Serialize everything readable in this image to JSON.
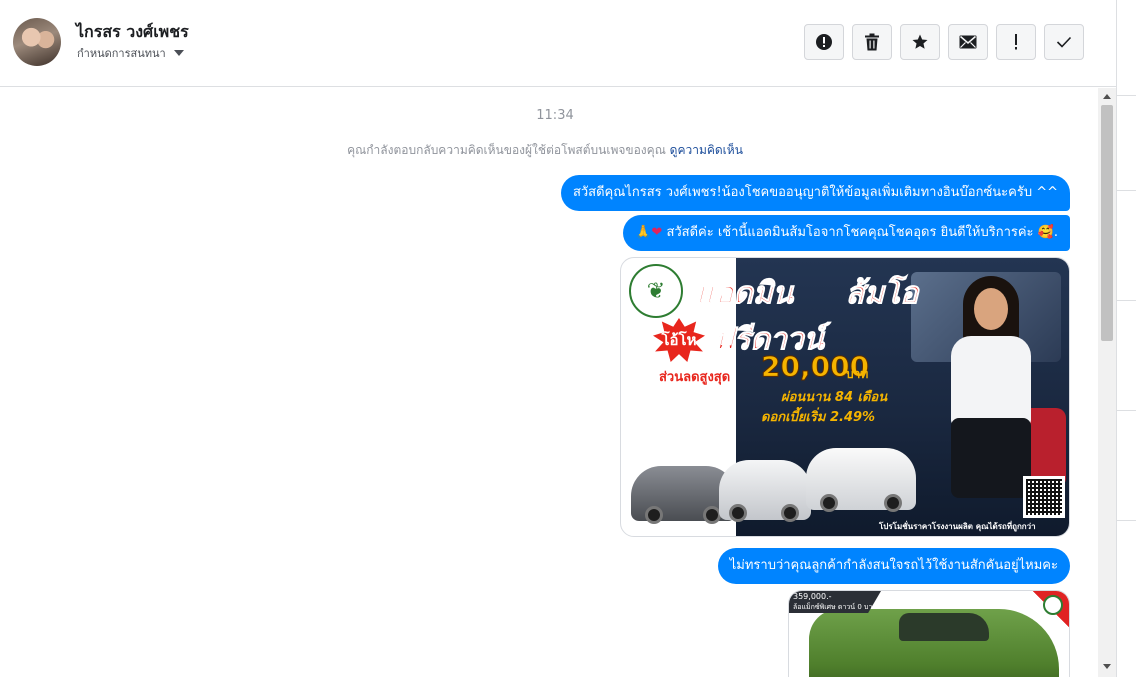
{
  "header": {
    "name": "ไกรสร วงศ์เพชร",
    "subtitle": "กำหนดการสนทนา"
  },
  "toolbar": {
    "buttons": [
      {
        "icon": "alert-circle-icon",
        "glyph": "!"
      },
      {
        "icon": "trash-icon"
      },
      {
        "icon": "star-icon"
      },
      {
        "icon": "envelope-icon"
      },
      {
        "icon": "exclamation-icon",
        "glyph": "!"
      },
      {
        "icon": "check-icon"
      }
    ]
  },
  "conversation": {
    "timestamp": "11:34",
    "notice_text": "คุณกำลังตอบกลับความคิดเห็นของผู้ใช้ต่อโพสต์บนเพจของคุณ",
    "notice_link": "ดูความคิดเห็น",
    "messages": [
      {
        "text": "สวัสดีคุณไกรสร วงศ์เพชร!น้องโชคขออนุญาติให้ข้อมูลเพิ่มเติมทางอินบ๊อกซ์นะครับ ^^"
      },
      {
        "prefix": "🙏",
        "heart": "❤",
        "text": " สวัสดีค่ะ เช้านี้แอดมินส้มโอจากโชคคุณโชคอุดร ยินดีให้บริการค่ะ 🥰."
      },
      {
        "text": "ไม่ทราบว่าคุณลูกค้ากำลังสนใจรถไว้ใช้งานสักคันอยู่ไหมคะ"
      }
    ],
    "promo_image": {
      "line1a": "แอดมิน",
      "line1b": "ส้มโอ",
      "badge": "โอ้โห",
      "headline": "ฟรีดาวน์",
      "discount_label": "ส่วนลดสูงสุด",
      "discount_amount": "20,000",
      "currency": "บาท",
      "installment": "ผ่อนนาน 84 เดือน",
      "interest": "ดอกเบี้ยเริ่ม 2.49%",
      "footer": "โปรโมชั่นราคาโรงงานผลิต คุณได้รถที่ถูกกว่า"
    },
    "promo_image2": {
      "price": "359,000.-",
      "note": "ล้อแม็กซ์พิเศษ ดาวน์ 0 บาท"
    }
  },
  "colors": {
    "bubble": "#0084ff",
    "link": "#1d4e9b",
    "muted": "#90949c"
  }
}
